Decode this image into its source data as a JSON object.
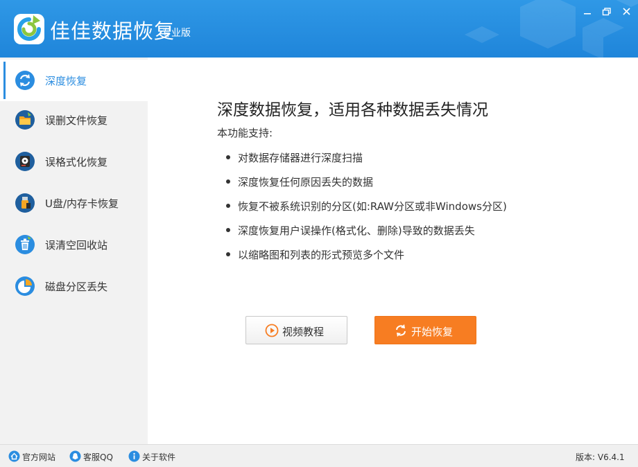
{
  "app": {
    "name": "佳佳数据恢复",
    "edition": "专业版"
  },
  "window_controls": [
    "minimize-icon",
    "maximize-icon",
    "close-icon"
  ],
  "sidebar": {
    "items": [
      {
        "label": "深度恢复",
        "icon": "deep-recovery-icon",
        "active": true
      },
      {
        "label": "误删文件恢复",
        "icon": "folder-icon",
        "active": false
      },
      {
        "label": "误格式化恢复",
        "icon": "disk-icon",
        "active": false
      },
      {
        "label": "U盘/内存卡恢复",
        "icon": "usb-icon",
        "active": false
      },
      {
        "label": "误清空回收站",
        "icon": "recycle-bin-icon",
        "active": false
      },
      {
        "label": "磁盘分区丢失",
        "icon": "pie-partition-icon",
        "active": false
      }
    ]
  },
  "main": {
    "title": "深度数据恢复，适用各种数据丢失情况",
    "support_label": "本功能支持:",
    "features": [
      "对数据存储器进行深度扫描",
      "深度恢复任何原因丢失的数据",
      "恢复不被系统识别的分区(如:RAW分区或非Windows分区)",
      "深度恢复用户误操作(格式化、删除)导致的数据丢失",
      "以缩略图和列表的形式预览多个文件"
    ],
    "buttons": {
      "video": "视频教程",
      "start": "开始恢复"
    }
  },
  "statusbar": {
    "website": "官方网站",
    "support_qq": "客服QQ",
    "about": "关于软件",
    "version": "版本: V6.4.1"
  },
  "colors": {
    "titlebar": "#1f85da",
    "accent": "#2b8de0",
    "start_button": "#f77d22",
    "sidebar_bg": "#f2f2f2"
  }
}
